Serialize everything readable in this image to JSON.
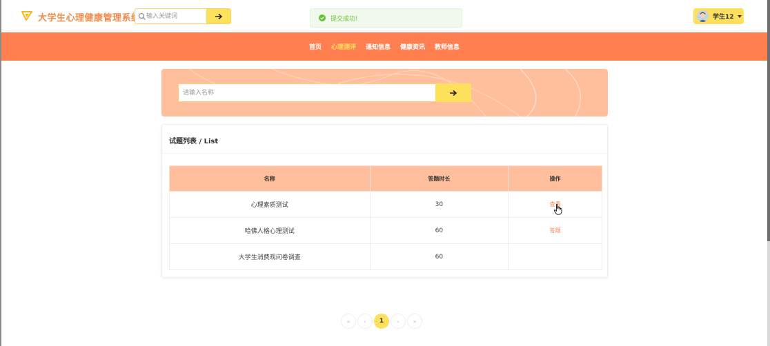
{
  "header": {
    "site_title": "大学生心理健康管理系统",
    "search_placeholder": "输入关键词",
    "toast_message": "提交成功!",
    "user_name": "学生12"
  },
  "nav": {
    "items": [
      {
        "label": "首页",
        "active": false
      },
      {
        "label": "心理测评",
        "active": true
      },
      {
        "label": "通知信息",
        "active": false
      },
      {
        "label": "健康资讯",
        "active": false
      },
      {
        "label": "教师信息",
        "active": false
      }
    ]
  },
  "banner": {
    "search_placeholder": "请输入名称"
  },
  "list": {
    "title": "试题列表 / List",
    "columns": [
      "名称",
      "答题时长",
      "操作"
    ],
    "rows": [
      {
        "name": "心理素质测试",
        "duration": "30",
        "action": "查看"
      },
      {
        "name": "哈佛人格心理测试",
        "duration": "60",
        "action": "答题"
      },
      {
        "name": "大学生消费观问卷调查",
        "duration": "60",
        "action": ""
      }
    ]
  },
  "pagination": {
    "first": "«",
    "prev": "‹",
    "current": "1",
    "next": "›",
    "last": "»"
  },
  "colors": {
    "brand_orange": "#ff7f50",
    "accent_yellow": "#fde05c",
    "banner_peach": "#ffbf9d",
    "title_orange": "#f08a4b",
    "success_green": "#67c23a"
  }
}
